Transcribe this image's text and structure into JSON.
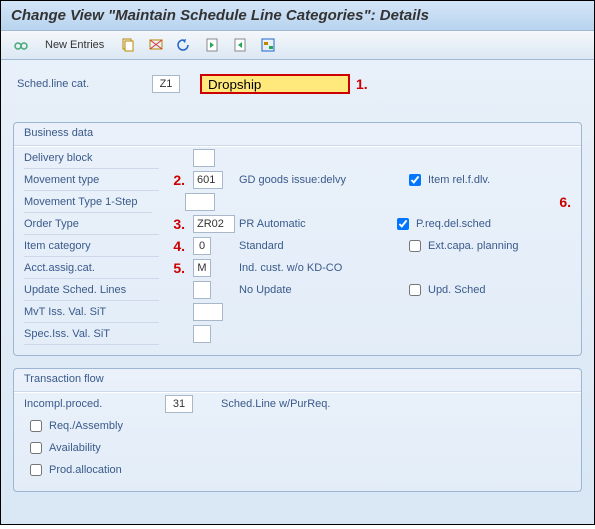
{
  "title": "Change View \"Maintain Schedule Line Categories\": Details",
  "toolbar": {
    "new_entries_label": "New Entries"
  },
  "header": {
    "sched_line_cat_label": "Sched.line cat.",
    "sched_line_cat_value": "Z1",
    "desc_value": "Dropship",
    "annot1": "1."
  },
  "business_data": {
    "group_title": "Business data",
    "delivery_block_label": "Delivery block",
    "delivery_block_value": "",
    "movement_type_label": "Movement type",
    "movement_type_value": "601",
    "movement_type_desc": "GD goods issue:delvy",
    "annot2": "2.",
    "item_rel_label": "Item rel.f.dlv.",
    "item_rel_checked": true,
    "movement_type_1step_label": "Movement Type 1-Step",
    "movement_type_1step_value": "",
    "order_type_label": "Order Type",
    "order_type_value": "ZR02",
    "order_type_desc": "PR Automatic",
    "annot3": "3.",
    "preq_label": "P.req.del.sched",
    "preq_checked": true,
    "annot6": "6.",
    "item_category_label": "Item category",
    "item_category_value": "0",
    "item_category_desc": "Standard",
    "annot4": "4.",
    "ext_capa_label": "Ext.capa. planning",
    "ext_capa_checked": false,
    "acct_assig_label": "Acct.assig.cat.",
    "acct_assig_value": "M",
    "acct_assig_desc": "Ind. cust. w/o KD-CO",
    "annot5": "5.",
    "update_sched_label": "Update Sched. Lines",
    "update_sched_value": "",
    "update_sched_desc": "No Update",
    "upd_sched_label": "Upd. Sched",
    "upd_sched_checked": false,
    "mvt_iss_label": "MvT Iss. Val. SiT",
    "mvt_iss_value": "",
    "spec_iss_label": "Spec.Iss. Val. SiT",
    "spec_iss_value": ""
  },
  "transaction_flow": {
    "group_title": "Transaction flow",
    "incompl_label": "Incompl.proced.",
    "incompl_value": "31",
    "incompl_desc": "Sched.Line w/PurReq.",
    "req_assembly_label": "Req./Assembly",
    "req_assembly_checked": false,
    "availability_label": "Availability",
    "availability_checked": false,
    "prod_allocation_label": "Prod.allocation",
    "prod_allocation_checked": false
  }
}
